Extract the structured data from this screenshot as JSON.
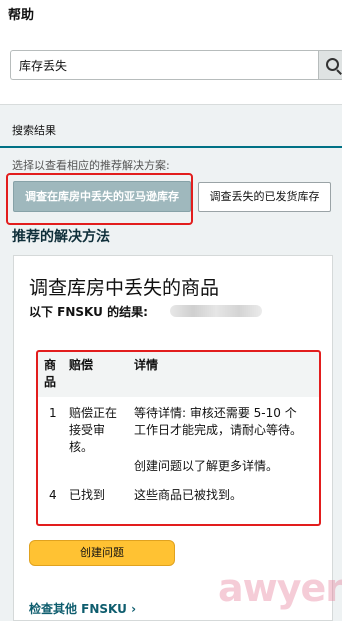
{
  "header": {
    "title": "帮助"
  },
  "search": {
    "value": "库存丢失"
  },
  "results": {
    "tab_label": "搜索结果",
    "choose_text": "选择以查看相应的推荐解决方案:",
    "options": [
      {
        "label": "调查在库房中丢失的亚马逊库存",
        "selected": true
      },
      {
        "label": "调查丢失的已发货库存",
        "selected": false
      }
    ]
  },
  "recommend": {
    "heading": "推荐的解决方法",
    "card_title": "调查库房中丢失的商品",
    "fnsku_label": "以下 FNSKU 的结果:",
    "table": {
      "headers": {
        "item": "商品",
        "compensation": "赔偿",
        "details": "详情"
      },
      "rows": [
        {
          "item": "1",
          "compensation": "赔偿正在接受审核。",
          "details": "等待详情:  审核还需要 5-10 个工作日才能完成，请耐心等待。",
          "details_extra": "创建问题以了解更多详情。"
        },
        {
          "item": "4",
          "compensation": "已找到",
          "details": "这些商品已被找到。",
          "details_extra": ""
        }
      ]
    },
    "create_button": "创建问题",
    "check_other_link": "检查其他 FNSKU ›"
  },
  "watermark": {
    "text": "awyerwu.com"
  },
  "colors": {
    "accent": "#007185",
    "highlight": "#e21d1d",
    "button_yellow": "#ffc233"
  }
}
